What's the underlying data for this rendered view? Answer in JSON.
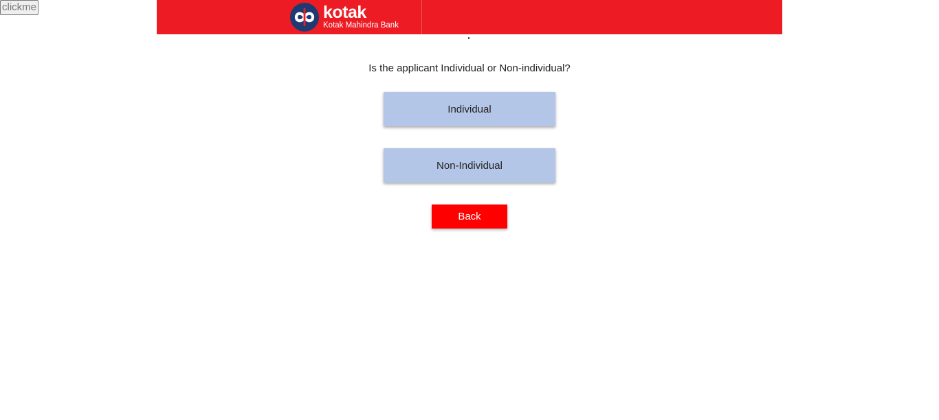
{
  "debug_button": {
    "label": "clickme"
  },
  "header": {
    "logo": {
      "icon": "kotak-infinity-logo-icon",
      "brand": "kotak",
      "tagline": "Kotak Mahindra Bank"
    },
    "colors": {
      "background": "#ed1c24"
    }
  },
  "main": {
    "question": "Is the applicant Individual or Non-individual?",
    "options": [
      {
        "label": "Individual"
      },
      {
        "label": "Non-Individual"
      }
    ],
    "back_label": "Back",
    "colors": {
      "option_background": "#b4c6e7",
      "back_background": "#ff0000"
    }
  }
}
